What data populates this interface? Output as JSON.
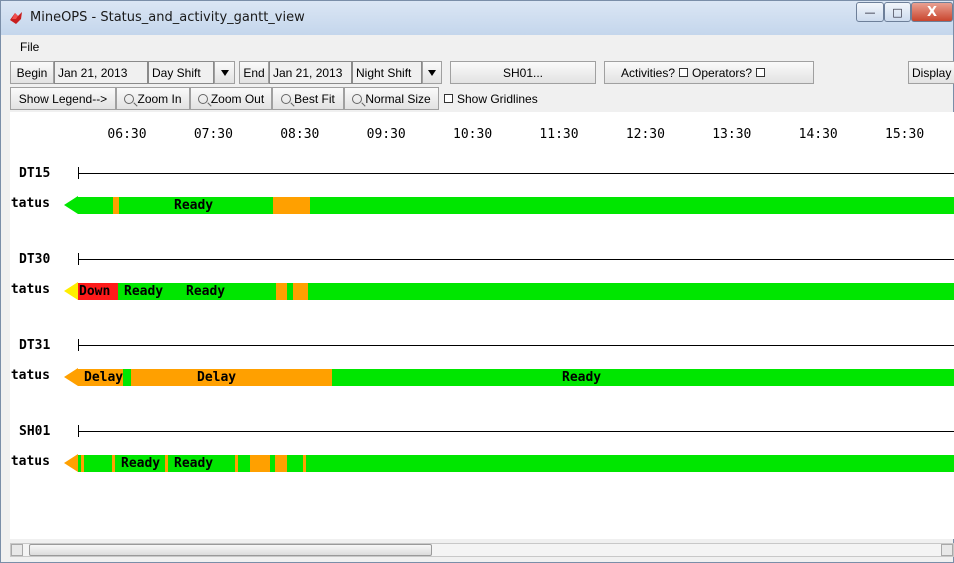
{
  "window": {
    "title": "MineOPS - Status_and_activity_gantt_view",
    "minimize": "—",
    "maximize": "□",
    "close": "X"
  },
  "menu": {
    "file": "File"
  },
  "toolbar1": {
    "begin_label": "Begin",
    "begin_date": "Jan 21, 2013",
    "begin_shift": "Day Shift",
    "end_label": "End",
    "end_date": "Jan 21, 2013",
    "end_shift": "Night Shift",
    "equipment": "SH01...",
    "activities_label": "Activities?",
    "operators_label": "Operators?",
    "display_label": "Display"
  },
  "toolbar2": {
    "legend": "Show Legend-->",
    "zoom_in": "Zoom In",
    "zoom_out": "Zoom Out",
    "best_fit": "Best Fit",
    "normal_size": "Normal Size",
    "gridlines": "Show Gridlines"
  },
  "timeline": [
    "06:30",
    "07:30",
    "08:30",
    "09:30",
    "10:30",
    "11:30",
    "12:30",
    "13:30",
    "14:30",
    "15:30"
  ],
  "colors": {
    "ready": "#00e600",
    "delay": "#ffa000",
    "down": "#ff1a1a",
    "unknown": "#ffee00"
  },
  "rows": [
    {
      "name": "DT15",
      "status_label": "Status",
      "arrow": "ready",
      "segments": [
        {
          "s": "ready",
          "w": 35,
          "t": ""
        },
        {
          "s": "delay",
          "w": 6,
          "t": ""
        },
        {
          "s": "ready",
          "w": 154,
          "t": "Ready"
        },
        {
          "s": "delay",
          "w": 9,
          "t": ""
        },
        {
          "s": "delay",
          "w": 18,
          "t": ""
        },
        {
          "s": "delay",
          "w": 10,
          "t": ""
        },
        {
          "s": "ready",
          "w": 648,
          "t": ""
        }
      ]
    },
    {
      "name": "DT30",
      "status_label": "Status",
      "arrow": "unknown",
      "segments": [
        {
          "s": "down",
          "w": 40,
          "t": "Down"
        },
        {
          "s": "ready",
          "w": 62,
          "t": "Ready"
        },
        {
          "s": "ready",
          "w": 96,
          "t": "Ready"
        },
        {
          "s": "delay",
          "w": 11,
          "t": ""
        },
        {
          "s": "ready",
          "w": 6,
          "t": ""
        },
        {
          "s": "delay",
          "w": 15,
          "t": ""
        },
        {
          "s": "ready",
          "w": 650,
          "t": ""
        }
      ]
    },
    {
      "name": "DT31",
      "status_label": "Status",
      "arrow": "delay",
      "segments": [
        {
          "s": "delay",
          "w": 45,
          "t": "Delay"
        },
        {
          "s": "ready",
          "w": 8,
          "t": ""
        },
        {
          "s": "delay",
          "w": 176,
          "t": "Delay"
        },
        {
          "s": "delay",
          "w": 25,
          "t": ""
        },
        {
          "s": "ready",
          "w": 504,
          "t": "Ready"
        },
        {
          "s": "ready",
          "w": 122,
          "t": ""
        }
      ]
    },
    {
      "name": "SH01",
      "status_label": "Status",
      "arrow": "delay",
      "segments": [
        {
          "s": "ready",
          "w": 3,
          "t": ""
        },
        {
          "s": "delay",
          "w": 3,
          "t": ""
        },
        {
          "s": "ready",
          "w": 28,
          "t": ""
        },
        {
          "s": "delay",
          "w": 3,
          "t": ""
        },
        {
          "s": "ready",
          "w": 50,
          "t": "Ready"
        },
        {
          "s": "delay",
          "w": 3,
          "t": ""
        },
        {
          "s": "ready",
          "w": 67,
          "t": "Ready"
        },
        {
          "s": "delay",
          "w": 3,
          "t": ""
        },
        {
          "s": "ready",
          "w": 12,
          "t": ""
        },
        {
          "s": "delay",
          "w": 20,
          "t": ""
        },
        {
          "s": "ready",
          "w": 5,
          "t": ""
        },
        {
          "s": "delay",
          "w": 12,
          "t": ""
        },
        {
          "s": "ready",
          "w": 16,
          "t": ""
        },
        {
          "s": "delay",
          "w": 3,
          "t": ""
        },
        {
          "s": "ready",
          "w": 651,
          "t": ""
        }
      ]
    }
  ]
}
